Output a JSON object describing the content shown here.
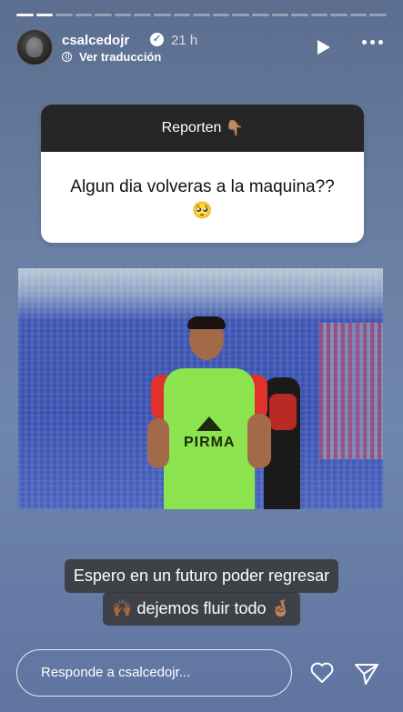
{
  "story": {
    "segments_total": 19,
    "segments_done": 2
  },
  "header": {
    "username": "csalcedojr",
    "verified": true,
    "time": "21 h",
    "translate_label": "Ver traducción",
    "icons": [
      "play-icon",
      "more-icon",
      "globe-icon",
      "verified-icon"
    ]
  },
  "question_box": {
    "header_label": "Reporten",
    "header_emoji": "👇🏽",
    "question": "Algun dia volveras a la maquina??",
    "question_emoji": "🥺"
  },
  "caption": {
    "line1": "Espero en un futuro poder regresar",
    "line2_prefix_emoji": "🙌🏾",
    "line2_text": "dejemos fluir todo",
    "line2_suffix_emoji": "🤞🏽"
  },
  "footer": {
    "reply_placeholder": "Responde a csalcedojr...",
    "icons": [
      "heart-icon",
      "send-icon"
    ]
  },
  "colors": {
    "background": "#6a7fa3",
    "question_header": "#262626",
    "jersey": "#8be34d"
  }
}
